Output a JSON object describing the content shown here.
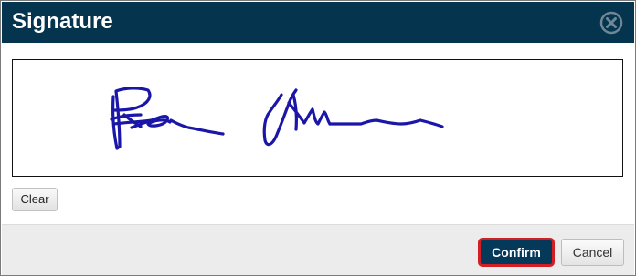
{
  "dialog": {
    "title": "Signature",
    "close_icon": "close-circle-icon"
  },
  "signature_pad": {
    "ink_color": "#1a16a8"
  },
  "actions": {
    "clear_label": "Clear",
    "confirm_label": "Confirm",
    "cancel_label": "Cancel"
  },
  "colors": {
    "header_bg": "#05344f",
    "confirm_bg": "#05395a",
    "focus_ring": "#d21f26"
  }
}
